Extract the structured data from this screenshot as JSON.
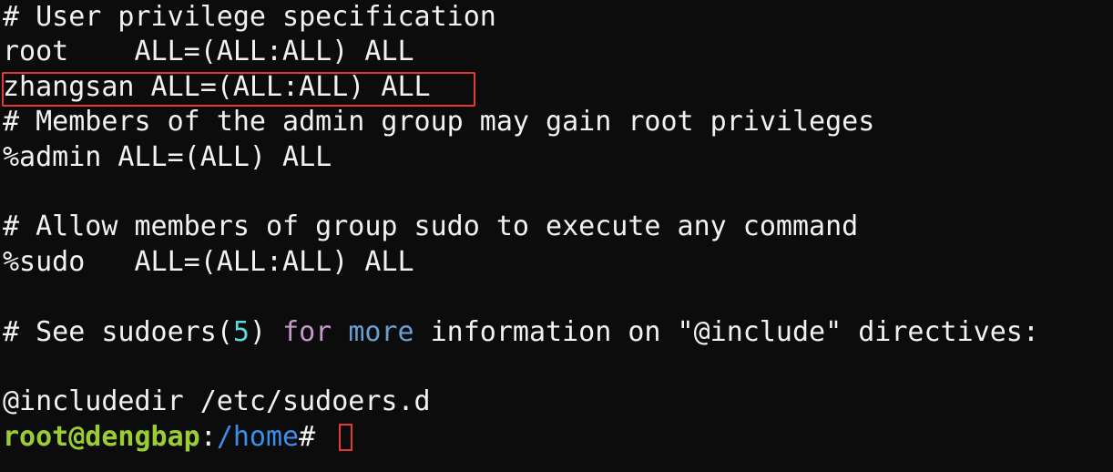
{
  "terminal": {
    "lines": {
      "l1": "# User privilege specification",
      "l2": "root    ALL=(ALL:ALL) ALL",
      "l3": "zhangsan ALL=(ALL:ALL) ALL",
      "l4": "# Members of the admin group may gain root privileges",
      "l5": "%admin ALL=(ALL) ALL",
      "l7": "# Allow members of group sudo to execute any command",
      "l8": "%sudo   ALL=(ALL:ALL) ALL",
      "l10_a": "# See sudoers(",
      "l10_num": "5",
      "l10_b": ") ",
      "l10_for": "for",
      "l10_sp": " ",
      "l10_more": "more",
      "l10_c": " information on \"@include\" directives:",
      "l12": "@includedir /etc/sudoers.d"
    },
    "prompt": {
      "user_host": "root@dengbap",
      "separator": ":",
      "path": "/home",
      "symbol": "# "
    },
    "highlight_color": "#e53935"
  }
}
